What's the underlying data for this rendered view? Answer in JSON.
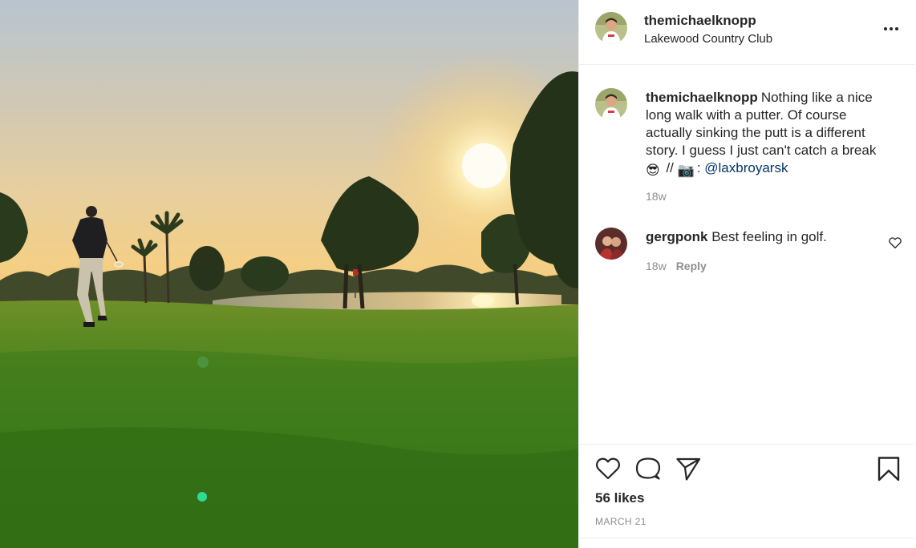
{
  "post": {
    "username": "themichaelknopp",
    "location": "Lakewood Country Club",
    "more_icon": "more-options-icon"
  },
  "caption": {
    "username": "themichaelknopp",
    "text": "Nothing like a nice long walk with a putter. Of course actually sinking the putt is a different story. I guess I just can't catch a break",
    "emoji_1": "😎",
    "separator": " // ",
    "emoji_2": "📷",
    "colon": ": ",
    "mention": "@laxbroyarsk",
    "time": "18w"
  },
  "comments": [
    {
      "username": "gergponk",
      "text": "Best feeling in golf.",
      "time": "18w",
      "reply_label": "Reply"
    }
  ],
  "footer": {
    "likes": "56 likes",
    "date": "MARCH 21"
  },
  "colors": {
    "text": "#262626",
    "secondary": "#8e8e8e",
    "link": "#00376b",
    "border": "#efefef"
  }
}
